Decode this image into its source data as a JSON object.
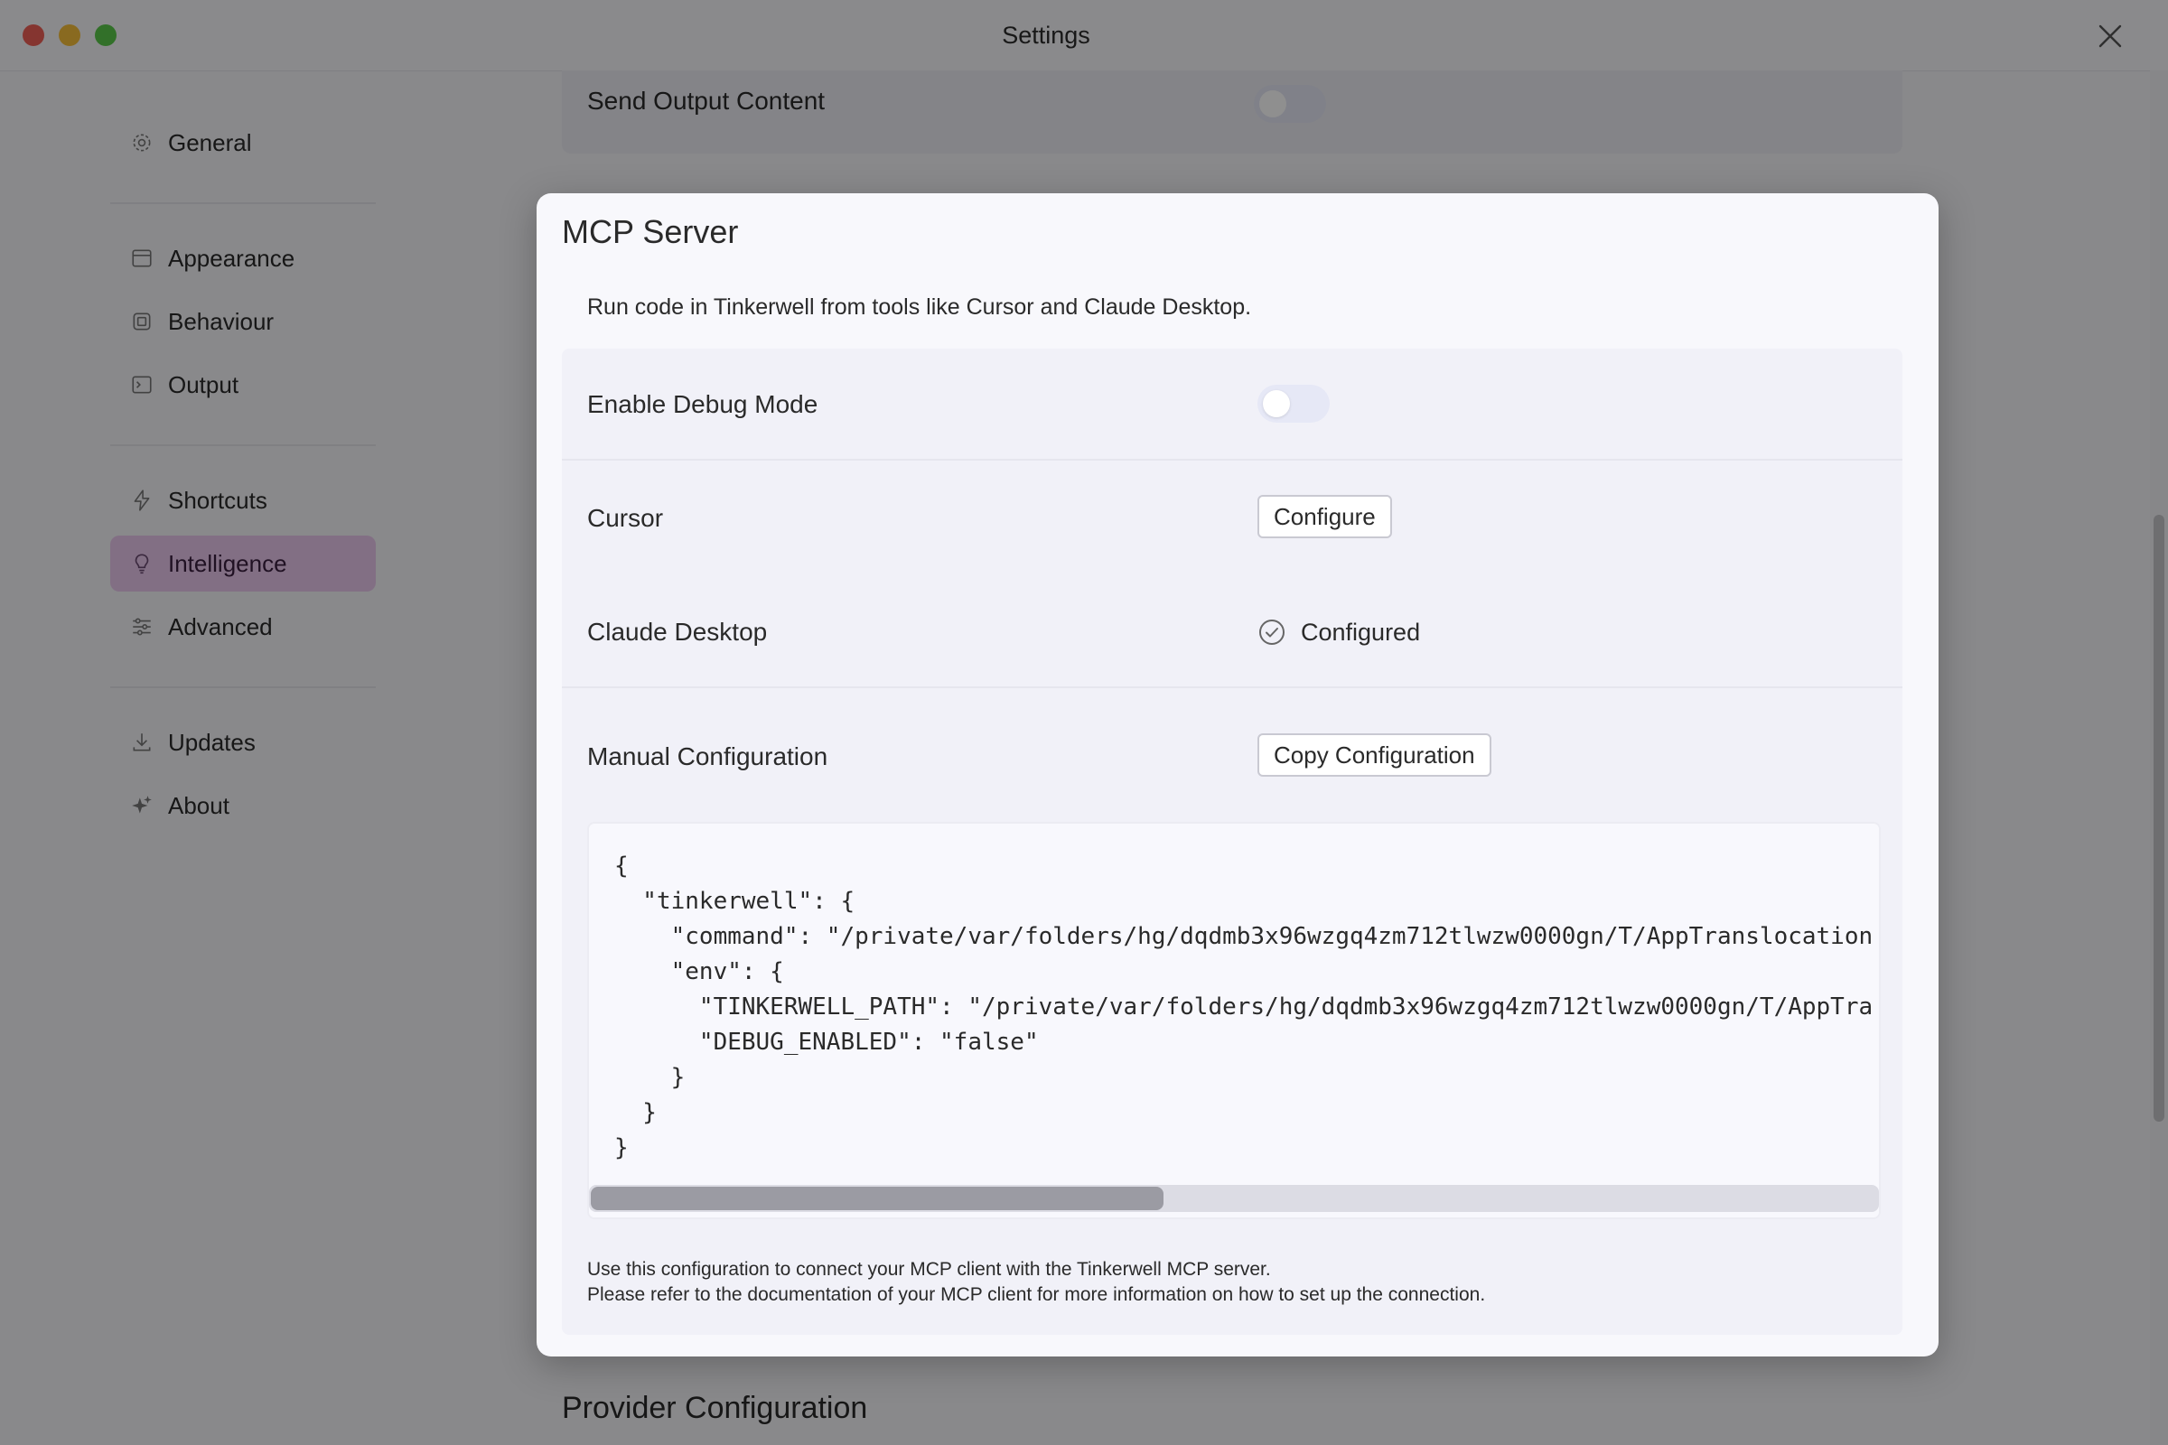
{
  "window": {
    "title": "Settings"
  },
  "sidebar": {
    "items": [
      {
        "label": "General",
        "icon": "gear-icon"
      },
      {
        "label": "Appearance",
        "icon": "window-icon"
      },
      {
        "label": "Behaviour",
        "icon": "chip-icon"
      },
      {
        "label": "Output",
        "icon": "terminal-icon"
      },
      {
        "label": "Shortcuts",
        "icon": "bolt-icon"
      },
      {
        "label": "Intelligence",
        "icon": "lightbulb-icon",
        "active": true
      },
      {
        "label": "Advanced",
        "icon": "sliders-icon"
      },
      {
        "label": "Updates",
        "icon": "download-icon"
      },
      {
        "label": "About",
        "icon": "sparkles-icon"
      }
    ]
  },
  "background": {
    "send_output_label": "Send Output Content",
    "provider_heading": "Provider Configuration"
  },
  "modal": {
    "title": "MCP Server",
    "description": "Run code in Tinkerwell from tools like Cursor and Claude Desktop.",
    "debug_label": "Enable Debug Mode",
    "cursor_label": "Cursor",
    "cursor_button": "Configure",
    "claude_label": "Claude Desktop",
    "claude_status": "Configured",
    "manual_label": "Manual Configuration",
    "copy_button": "Copy Configuration",
    "code_lines": [
      "{",
      "  \"tinkerwell\": {",
      "    \"command\": \"/private/var/folders/hg/dqdmb3x96wzgq4zm712tlwzw0000gn/T/AppTranslocation",
      "    \"env\": {",
      "      \"TINKERWELL_PATH\": \"/private/var/folders/hg/dqdmb3x96wzgq4zm712tlwzw0000gn/T/AppTra",
      "      \"DEBUG_ENABLED\": \"false\"",
      "    }",
      "  }",
      "}"
    ],
    "footer_line1": "Use this configuration to connect your MCP client with the Tinkerwell MCP server.",
    "footer_line2": "Please refer to the documentation of your MCP client for more information on how to set up the connection."
  },
  "colors": {
    "active_item": "#e8c6ec",
    "overlay": "#000000",
    "accent_close": "#ee5f57",
    "accent_minimize": "#f5bd3a",
    "accent_zoom": "#5ac84a"
  }
}
